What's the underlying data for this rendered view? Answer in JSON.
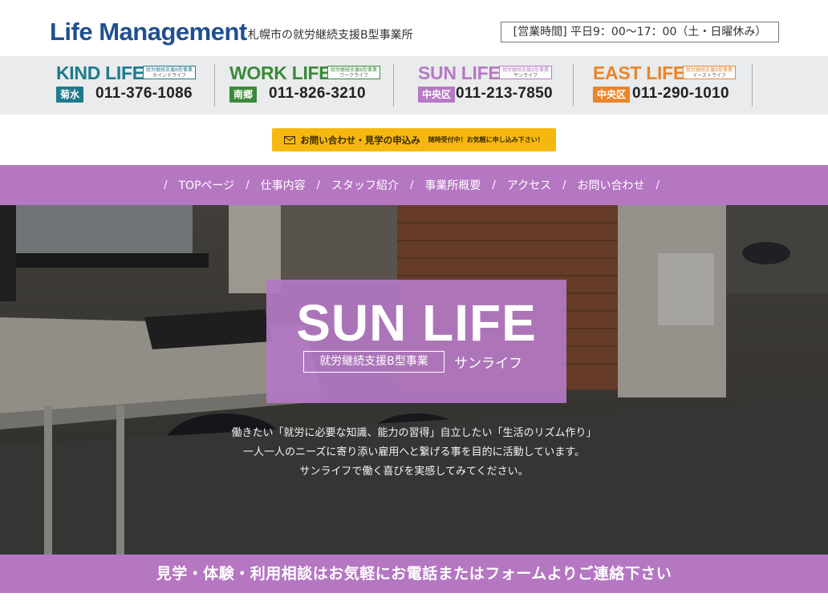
{
  "header": {
    "logo": "Life Management",
    "tagline": "札幌市の就労継続支援B型事業所",
    "hours": "[営業時間] 平日9：00〜17：00（土・日曜休み）"
  },
  "branches": [
    {
      "name": "KIND LIFE",
      "sub1": "就労継続支援B型事業",
      "sub2": "カインドライフ",
      "area": "菊水",
      "phone": "011-376-1086",
      "color": "#1f7a8c"
    },
    {
      "name": "WORK LIFE",
      "sub1": "就労継続支援B型事業",
      "sub2": "ワークライフ",
      "area": "南郷",
      "phone": "011-826-3210",
      "color": "#3a8a3a"
    },
    {
      "name": "SUN LIFE",
      "sub1": "就労継続支援B型事業",
      "sub2": "サンライフ",
      "area": "中央区",
      "phone": "011-213-7850",
      "color": "#b679c4"
    },
    {
      "name": "EAST LIFE",
      "sub1": "就労継続支援B型事業",
      "sub2": "イーストライフ",
      "area": "中央区",
      "phone": "011-290-1010",
      "color": "#e8862a"
    }
  ],
  "contact": {
    "main": "お問い合わせ・見学の申込み",
    "sub": "随時受付中！お気軽に申し込み下さい！"
  },
  "nav": {
    "separator": "/",
    "items": [
      "TOPページ",
      "仕事内容",
      "スタッフ紹介",
      "事業所概要",
      "アクセス",
      "お問い合わせ"
    ]
  },
  "hero": {
    "title": "SUN LIFE",
    "tag": "就労継続支援B型事業",
    "kana": "サンライフ",
    "lines": [
      "働きたい「就労に必要な知識、能力の習得」自立したい「生活のリズム作り」",
      "一人一人のニーズに寄り添い雇用へと繋げる事を目的に活動しています。",
      "サンライフで働く喜びを実感してみてください。"
    ]
  },
  "cta_band": "見学・体験・利用相談はお気軽にお電話またはフォームよりご連絡下さい",
  "colors": {
    "nav": "#b576c2",
    "contact_button": "#f6b80f",
    "logo": "#1f4f8f"
  }
}
